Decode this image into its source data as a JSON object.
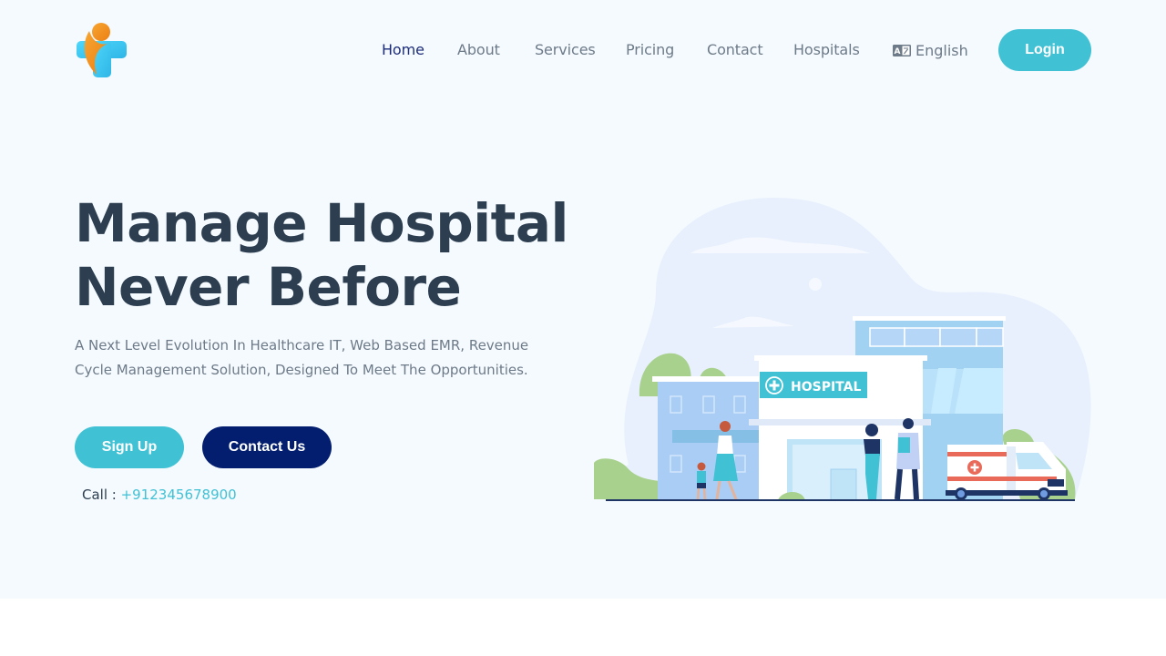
{
  "brand": {
    "logo_icon": "medical-cross-person-logo",
    "colors": {
      "accent": "#40c1d4",
      "primary_dark": "#031e6e",
      "heading": "#2c3e50",
      "nav_text": "#6d7a88",
      "nav_active": "#1d2d7a",
      "hero_bg": "#f5faff",
      "logo_orange": "#f3921e",
      "logo_cyan": "#3ec9f3"
    }
  },
  "nav": {
    "items": [
      {
        "label": "Home",
        "active": true
      },
      {
        "label": "About",
        "active": false
      },
      {
        "label": "Services",
        "active": false
      },
      {
        "label": "Pricing",
        "active": false
      },
      {
        "label": "Contact",
        "active": false
      },
      {
        "label": "Hospitals",
        "active": false
      }
    ],
    "language": {
      "icon": "translate-icon",
      "label": "English"
    },
    "login_label": "Login"
  },
  "hero": {
    "headline_line1": "Manage Hospital",
    "headline_line2": "Never Before",
    "subtext": "A Next Level Evolution In Healthcare IT, Web Based EMR, Revenue Cycle Management Solution, Designed To Meet The Opportunities.",
    "signup_label": "Sign Up",
    "contact_label": "Contact Us",
    "call_label": "Call :",
    "phone": "+912345678900"
  },
  "illustration": {
    "sign_text": "HOSPITAL",
    "description": "Hospital building with people and ambulance"
  }
}
